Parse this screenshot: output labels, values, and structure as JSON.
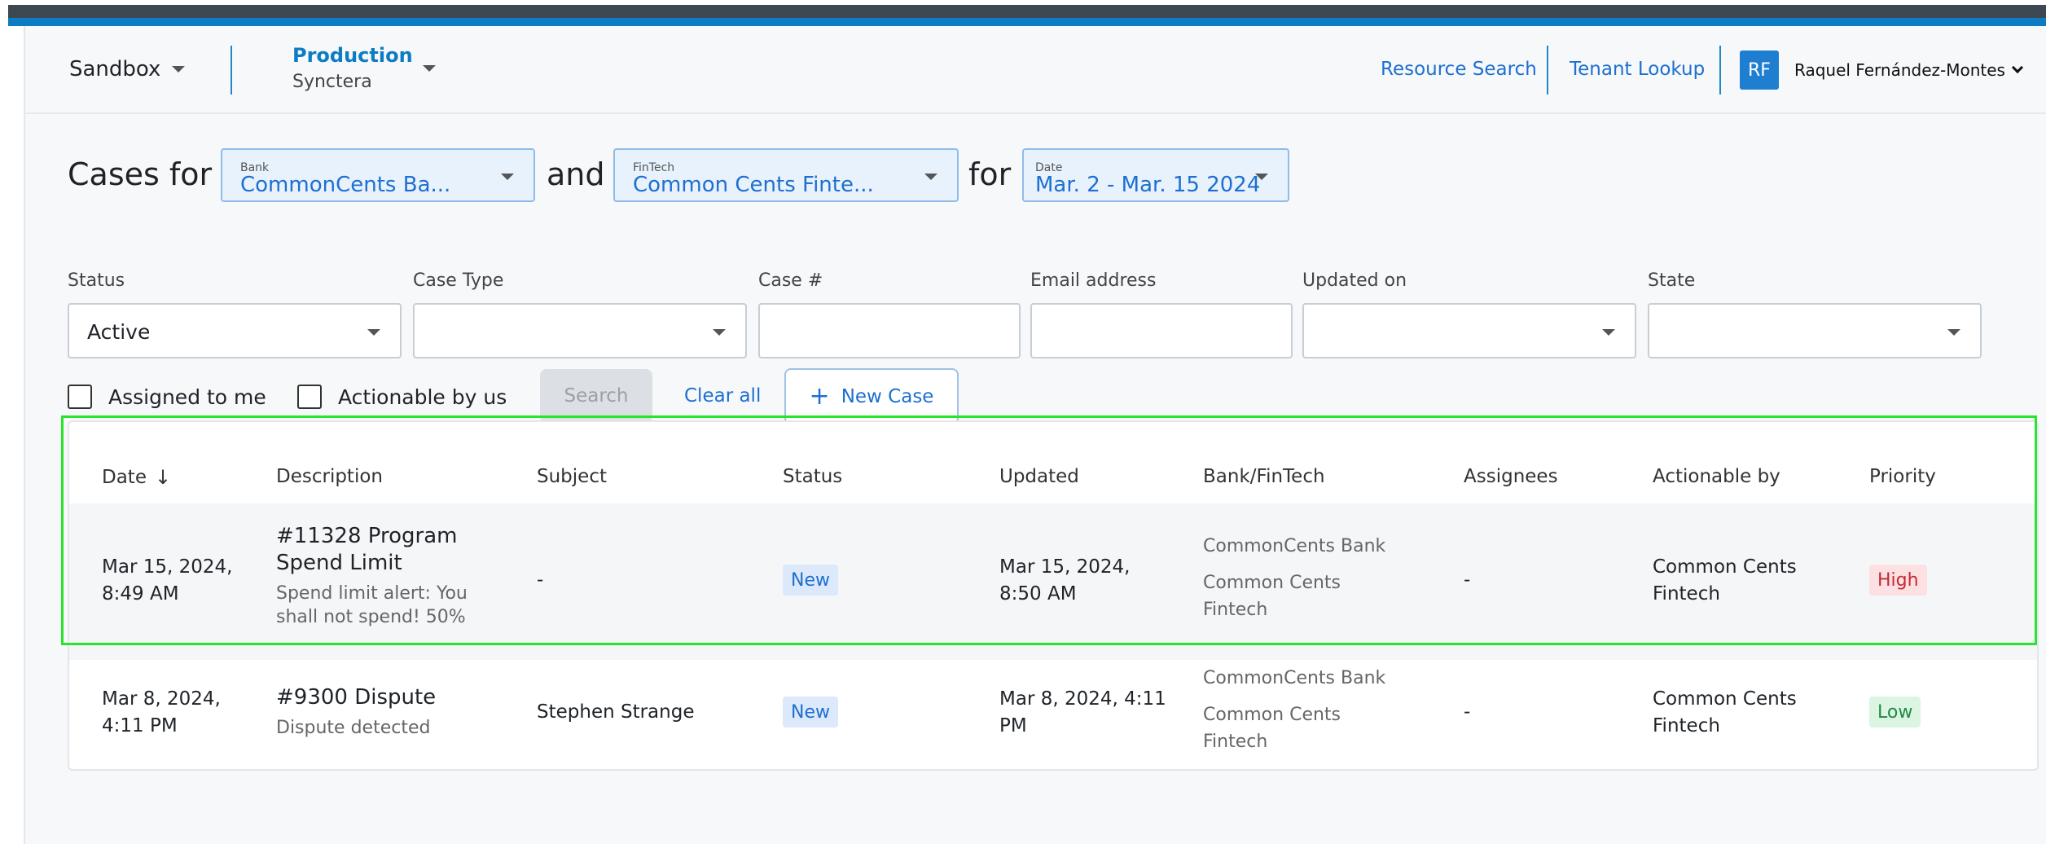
{
  "header": {
    "env_sandbox": "Sandbox",
    "env_production": "Production",
    "env_production_sub": "Synctera",
    "links": [
      "Resource Search",
      "Tenant Lookup"
    ],
    "avatar_initials": "RF",
    "user_name": "Raquel Fernández-Montes"
  },
  "query": {
    "cases_for": "Cases for",
    "and": "and",
    "for": "for",
    "bank": {
      "label": "Bank",
      "value": "CommonCents Ba..."
    },
    "fintech": {
      "label": "FinTech",
      "value": "Common Cents Finte..."
    },
    "date": {
      "label": "Date",
      "value": "Mar. 2 - Mar. 15 2024"
    }
  },
  "filters": {
    "status": {
      "label": "Status",
      "value": "Active"
    },
    "case_type": {
      "label": "Case Type",
      "value": ""
    },
    "case_number": {
      "label": "Case #",
      "value": ""
    },
    "email": {
      "label": "Email address",
      "value": ""
    },
    "updated_on": {
      "label": "Updated on",
      "value": ""
    },
    "state": {
      "label": "State",
      "value": ""
    }
  },
  "actions": {
    "assigned_to_me": "Assigned to me",
    "actionable_by_us": "Actionable by us",
    "search": "Search",
    "clear_all": "Clear all",
    "new_case": "New Case"
  },
  "table": {
    "columns": [
      "Date",
      "Description",
      "Subject",
      "Status",
      "Updated",
      "Bank/FinTech",
      "Assignees",
      "Actionable by",
      "Priority"
    ],
    "rows": [
      {
        "date_line1": "Mar 15, 2024,",
        "date_line2": "8:49 AM",
        "title_line1": "#11328 Program",
        "title_line2": "Spend Limit",
        "desc_line1": "Spend limit alert: You",
        "desc_line2": "shall not spend! 50%",
        "subject": "-",
        "status": "New",
        "updated_line1": "Mar 15, 2024,",
        "updated_line2": "8:50 AM",
        "bank": "CommonCents Bank",
        "fintech_line1": "Common Cents",
        "fintech_line2": "Fintech",
        "assignees": "-",
        "actionable_line1": "Common Cents",
        "actionable_line2": "Fintech",
        "priority": "High"
      },
      {
        "date_line1": "Mar 8, 2024,",
        "date_line2": "4:11 PM",
        "title_line1": "#9300 Dispute",
        "desc_line1": "Dispute detected",
        "subject": "Stephen Strange",
        "status": "New",
        "updated_line1": "Mar 8, 2024, 4:11",
        "updated_line2": "PM",
        "bank": "CommonCents Bank",
        "fintech_line1": "Common Cents",
        "fintech_line2": "Fintech",
        "assignees": "-",
        "actionable_line1": "Common Cents",
        "actionable_line2": "Fintech",
        "priority": "Low"
      }
    ]
  },
  "colors": {
    "accent": "#0d7cc4",
    "link": "#1e6fd0",
    "highlight": "#27e52b",
    "priority_high": "#c62835",
    "priority_low": "#1f8a46"
  }
}
